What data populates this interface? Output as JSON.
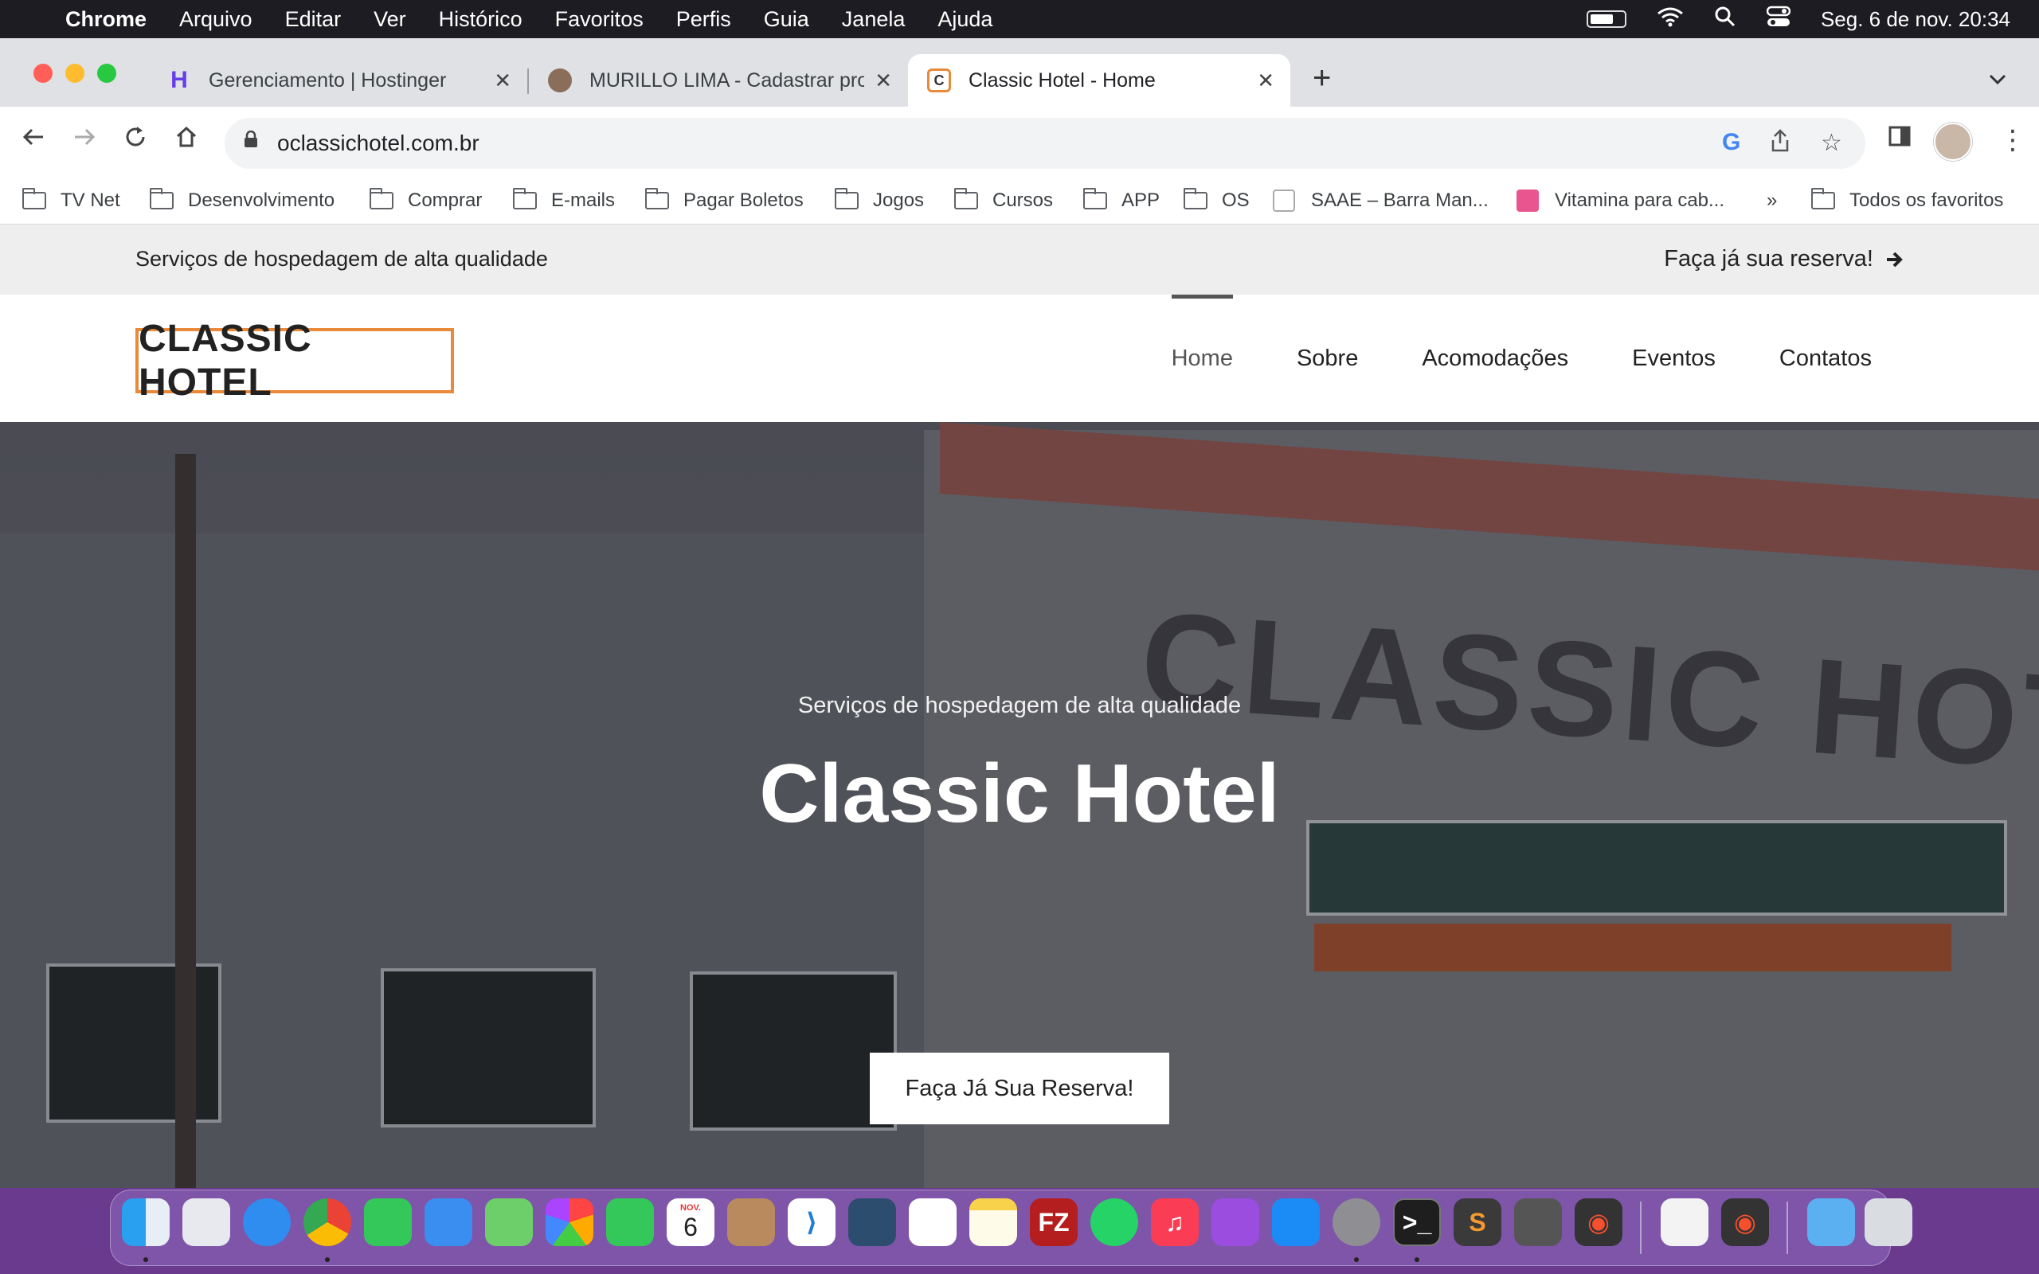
{
  "menubar": {
    "app": "Chrome",
    "items": [
      "Arquivo",
      "Editar",
      "Ver",
      "Histórico",
      "Favoritos",
      "Perfis",
      "Guia",
      "Janela",
      "Ajuda"
    ],
    "datetime": "Seg. 6 de nov.  20:34"
  },
  "tabs": [
    {
      "title": "Gerenciamento | Hostinger"
    },
    {
      "title": "MURILLO LIMA - Cadastrar pro"
    },
    {
      "title": "Classic Hotel - Home"
    }
  ],
  "omnibox": {
    "url": "oclassichotel.com.br"
  },
  "bookmarks": [
    "TV Net",
    "Desenvolvimento",
    "Comprar",
    "E-mails",
    "Pagar Boletos",
    "Jogos",
    "Cursos",
    "APP",
    "OS",
    "SAAE – Barra Man...",
    "Vitamina para cab...",
    "»",
    "Todos os favoritos"
  ],
  "site": {
    "topbar_tagline": "Serviços de hospedagem de alta qualidade",
    "topbar_reserve": "Faça já sua reserva!",
    "logo": "CLASSIC HOTEL",
    "nav": [
      "Home",
      "Sobre",
      "Acomodações",
      "Eventos",
      "Contatos"
    ],
    "hero_sign": "CLASSIC HOTEL",
    "hero_subtitle": "Serviços de hospedagem de alta qualidade",
    "hero_title": "Classic Hotel",
    "hero_button": "Faça Já Sua Reserva!"
  },
  "dock": {
    "calendar_month": "NOV.",
    "calendar_day": "6"
  },
  "colors": {
    "logo_border": "#e88a3a",
    "menubar_bg": "#1c1c22",
    "tabstrip_bg": "#dfe1e5",
    "topbar_bg": "#eeeeee"
  }
}
